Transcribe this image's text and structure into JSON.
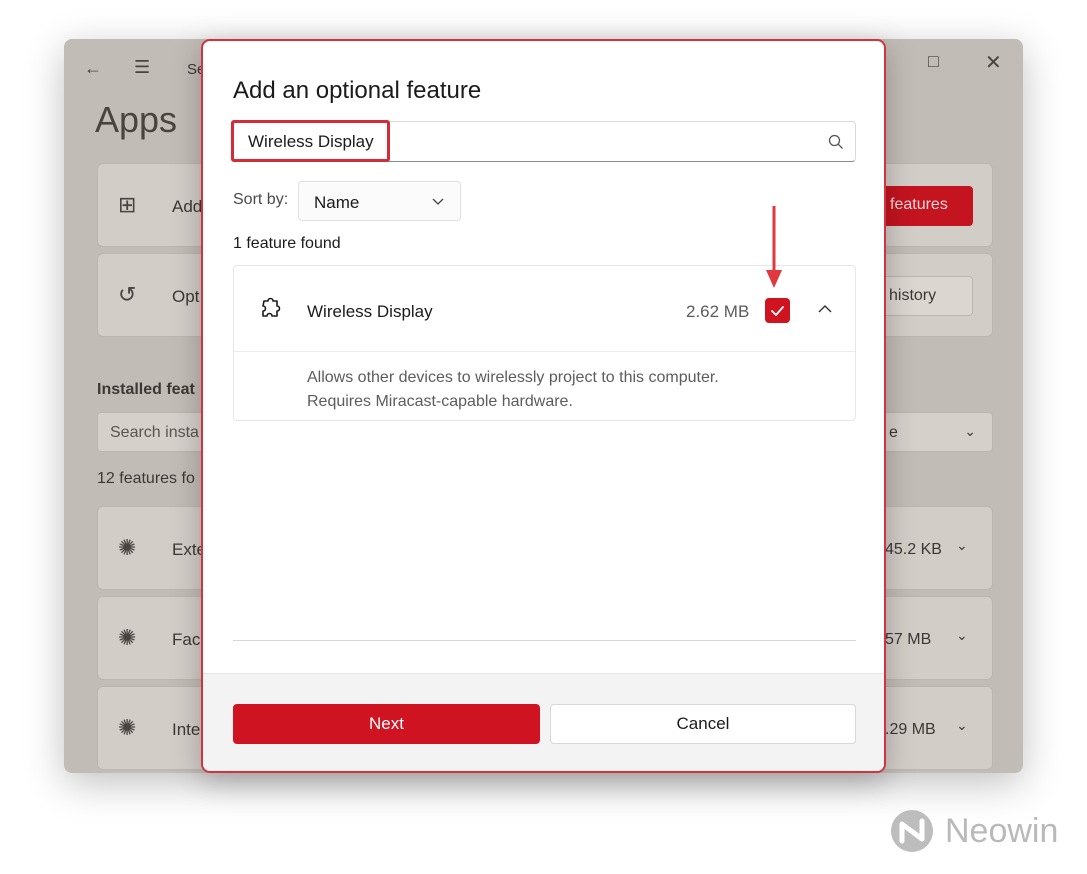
{
  "background": {
    "window_title": "Se",
    "page_heading": "Apps",
    "card1_text": "Add",
    "view_features_fragment": "features",
    "card2_text": "Opt",
    "history_fragment": "history",
    "installed_heading": "Installed feat",
    "search_placeholder": "Search insta",
    "sort_fragment": "e",
    "count_fragment": "12 features fo",
    "rows": [
      {
        "name": "Exte",
        "size": "45.2 KB"
      },
      {
        "name": "Faci",
        "size": "57 MB"
      },
      {
        "name": "Inte",
        "size": ".29 MB"
      }
    ]
  },
  "dialog": {
    "title": "Add an optional feature",
    "search": {
      "value": "Wireless Display"
    },
    "sort": {
      "label": "Sort by:",
      "value": "Name"
    },
    "results_count": "1 feature found",
    "feature": {
      "name": "Wireless Display",
      "size": "2.62 MB",
      "checked": true,
      "description_line1": "Allows other devices to wirelessly project to this computer.",
      "description_line2": "Requires Miracast-capable hardware."
    },
    "buttons": {
      "next": "Next",
      "cancel": "Cancel"
    }
  },
  "colors": {
    "accent": "#cf1320",
    "annotation": "#e0383f"
  },
  "watermark": {
    "text": "Neowin"
  }
}
